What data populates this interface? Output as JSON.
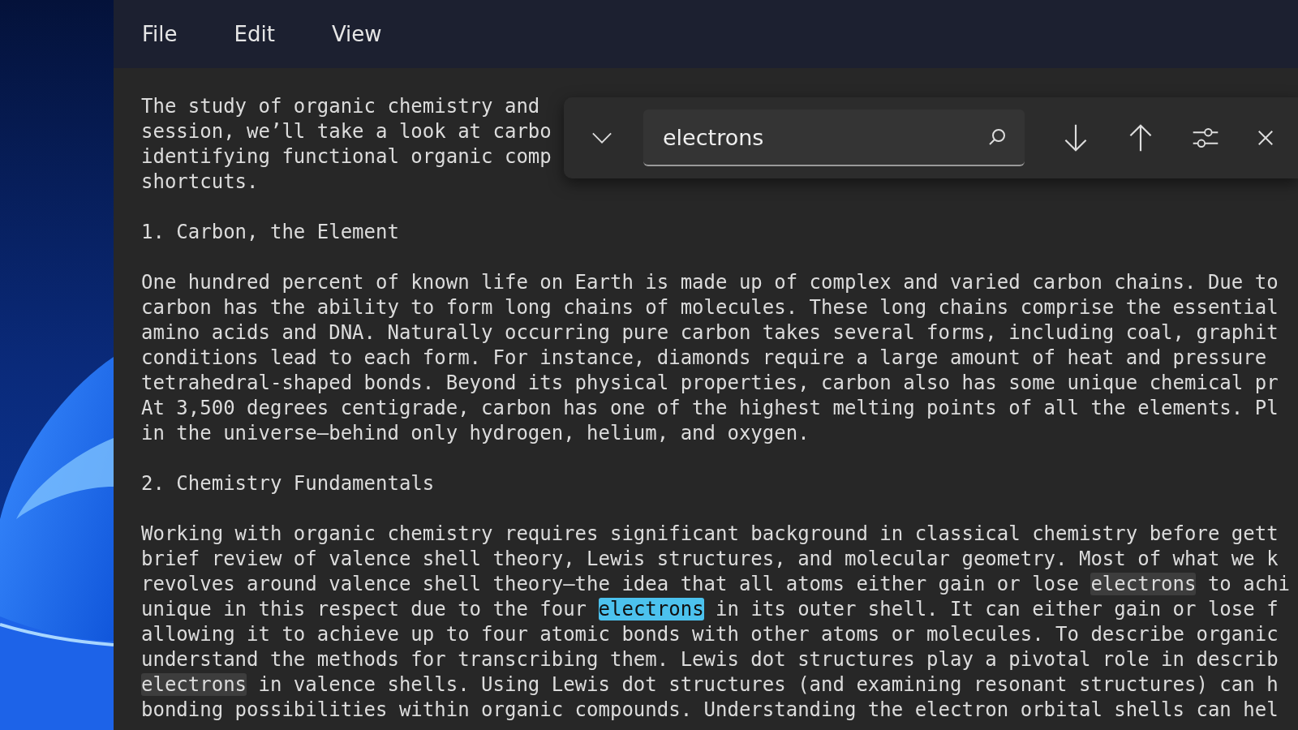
{
  "menu": [
    {
      "label": "File"
    },
    {
      "label": "Edit"
    },
    {
      "label": "View"
    }
  ],
  "find_bar": {
    "query": "electrons"
  },
  "paragraphs": [
    {
      "lines": [
        [
          {
            "text": "The study of organic chemistry and",
            "kind": "plain"
          }
        ],
        [
          {
            "text": "session, we’ll take a look at carbo",
            "kind": "plain"
          }
        ],
        [
          {
            "text": "identifying functional organic comp",
            "kind": "plain"
          }
        ],
        [
          {
            "text": "shortcuts.",
            "kind": "plain"
          }
        ]
      ]
    },
    {
      "lines": [
        [
          {
            "text": "1. Carbon, the Element",
            "kind": "plain"
          }
        ]
      ]
    },
    {
      "lines": [
        [
          {
            "text": "One hundred percent of known life on Earth is made up of complex and varied carbon chains. Due to",
            "kind": "plain"
          }
        ],
        [
          {
            "text": "carbon has the ability to form long chains of molecules. These long chains comprise the essential",
            "kind": "plain"
          }
        ],
        [
          {
            "text": "amino acids and DNA. Naturally occurring pure carbon takes several forms, including coal, graphit",
            "kind": "plain"
          }
        ],
        [
          {
            "text": "conditions lead to each form. For instance, diamonds require a large amount of heat and pressure",
            "kind": "plain"
          }
        ],
        [
          {
            "text": "tetrahedral-shaped bonds. Beyond its physical properties, carbon also has some unique chemical pr",
            "kind": "plain"
          }
        ],
        [
          {
            "text": "At 3,500 degrees centigrade, carbon has one of the highest melting points of all the elements. Pl",
            "kind": "plain"
          }
        ],
        [
          {
            "text": "in the universe—behind only hydrogen, helium, and oxygen.",
            "kind": "plain"
          }
        ]
      ]
    },
    {
      "lines": [
        [
          {
            "text": "2. Chemistry Fundamentals",
            "kind": "plain"
          }
        ]
      ]
    },
    {
      "lines": [
        [
          {
            "text": "Working with organic chemistry requires significant background in classical chemistry before gett",
            "kind": "plain"
          }
        ],
        [
          {
            "text": "brief review of valence shell theory, Lewis structures, and molecular geometry. Most of what we k",
            "kind": "plain"
          }
        ],
        [
          {
            "text": "revolves around valence shell theory—the idea that all atoms either gain or lose ",
            "kind": "plain"
          },
          {
            "text": "electrons",
            "kind": "match"
          },
          {
            "text": " to achi",
            "kind": "plain"
          }
        ],
        [
          {
            "text": "unique in this respect due to the four ",
            "kind": "plain"
          },
          {
            "text": "electrons",
            "kind": "current"
          },
          {
            "text": " in its outer shell. It can either gain or lose f",
            "kind": "plain"
          }
        ],
        [
          {
            "text": "allowing it to achieve up to four atomic bonds with other atoms or molecules. To describe organic",
            "kind": "plain"
          }
        ],
        [
          {
            "text": "understand the methods for transcribing them. Lewis dot structures play a pivotal role in describ",
            "kind": "plain"
          }
        ],
        [
          {
            "text": "electrons",
            "kind": "match"
          },
          {
            "text": " in valence shells. Using Lewis dot structures (and examining resonant structures) can h",
            "kind": "plain"
          }
        ],
        [
          {
            "text": "bonding possibilities within organic compounds. Understanding the electron orbital shells can hel",
            "kind": "plain"
          }
        ]
      ]
    }
  ]
}
